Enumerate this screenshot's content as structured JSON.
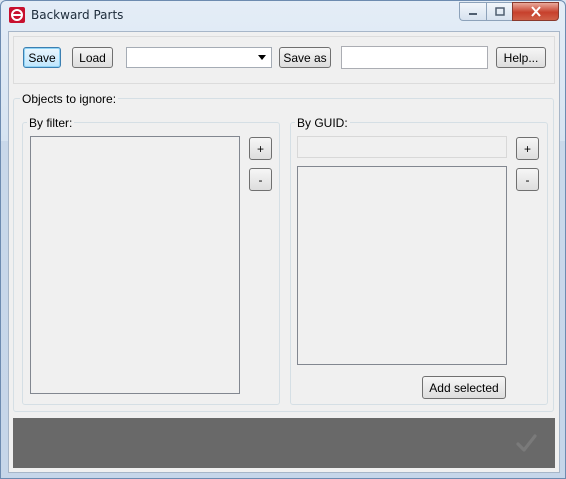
{
  "window": {
    "title": "Backward Parts",
    "icon": "app-logo-icon",
    "controls": [
      "minimize-icon",
      "maximize-icon",
      "close-icon"
    ]
  },
  "toolbar": {
    "save_label": "Save",
    "load_label": "Load",
    "preset_select_value": "",
    "save_as_label": "Save as",
    "save_as_name_value": "",
    "help_label": "Help..."
  },
  "ignore": {
    "title": "Objects to ignore:",
    "by_filter": {
      "title": "By filter:",
      "add_label": "+",
      "remove_label": "-",
      "items": []
    },
    "by_guid": {
      "title": "By GUID:",
      "guid_input_value": "",
      "add_label": "+",
      "remove_label": "-",
      "items": [],
      "add_selected_label": "Add selected"
    }
  },
  "footer": {
    "apply_icon": "checkmark-icon",
    "colors": {
      "panel": "#696969",
      "check": "#7a7a7a"
    }
  }
}
